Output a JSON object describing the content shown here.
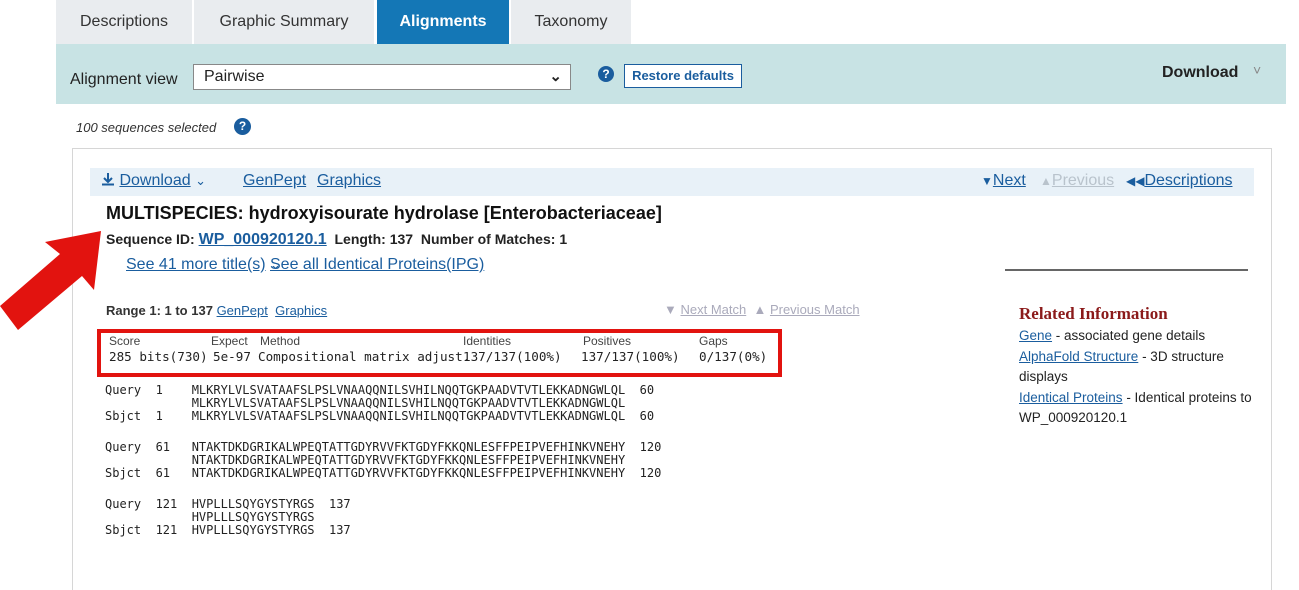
{
  "tabs": [
    {
      "label": "Descriptions"
    },
    {
      "label": "Graphic Summary"
    },
    {
      "label": "Alignments"
    },
    {
      "label": "Taxonomy"
    }
  ],
  "toolbar": {
    "alignment_view_label": "Alignment view",
    "alignment_view_value": "Pairwise",
    "help_glyph": "?",
    "restore_defaults": "Restore defaults",
    "download": "Download",
    "download_chevron": "˅"
  },
  "selection": {
    "text": "100 sequences selected",
    "help_glyph": "?"
  },
  "hit_bar": {
    "download": "Download",
    "genpept": "GenPept",
    "graphics": "Graphics",
    "next": "Next",
    "previous": "Previous",
    "descriptions": "Descriptions"
  },
  "hit": {
    "title": "MULTISPECIES: hydroxyisourate hydrolase [Enterobacteriaceae]",
    "seq_id_label": "Sequence ID:",
    "seq_id": "WP_000920120.1",
    "length_label": "Length:",
    "length": "137",
    "matches_label": "Number of Matches:",
    "matches": "1",
    "more_titles": "See 41 more title(s)",
    "ipg": "See all Identical Proteins(IPG)"
  },
  "range": {
    "label": "Range 1: 1 to 137",
    "genpept": "GenPept",
    "graphics": "Graphics",
    "next_match": "Next Match",
    "previous_match": "Previous Match"
  },
  "scores": {
    "headers": [
      "Score",
      "Expect",
      "Method",
      "Identities",
      "Positives",
      "Gaps"
    ],
    "values": [
      "285 bits(730)",
      "5e-97",
      "Compositional matrix adjust.",
      "137/137(100%)",
      "137/137(100%)",
      "0/137(0%)"
    ]
  },
  "alignment": [
    {
      "query": "Query  1    MLKRYLVLSVATAAFSLPSLVNAAQQNILSVHILNQQTGKPAADVTVTLEKKADNGWLQL  60",
      "middle": "            MLKRYLVLSVATAAFSLPSLVNAAQQNILSVHILNQQTGKPAADVTVTLEKKADNGWLQL",
      "sbjct": "Sbjct  1    MLKRYLVLSVATAAFSLPSLVNAAQQNILSVHILNQQTGKPAADVTVTLEKKADNGWLQL  60"
    },
    {
      "query": "Query  61   NTAKTDKDGRIKALWPEQTATTGDYRVVFKTGDYFKKQNLESFFPEIPVEFHINKVNEHY  120",
      "middle": "            NTAKTDKDGRIKALWPEQTATTGDYRVVFKTGDYFKKQNLESFFPEIPVEFHINKVNEHY",
      "sbjct": "Sbjct  61   NTAKTDKDGRIKALWPEQTATTGDYRVVFKTGDYFKKQNLESFFPEIPVEFHINKVNEHY  120"
    },
    {
      "query": "Query  121  HVPLLLSQYGYSTYRGS  137",
      "middle": "            HVPLLLSQYGYSTYRGS",
      "sbjct": "Sbjct  121  HVPLLLSQYGYSTYRGS  137"
    }
  ],
  "related": {
    "title": "Related Information",
    "items": [
      {
        "link": "Gene",
        "text": " - associated gene details"
      },
      {
        "link": "AlphaFold Structure",
        "text": " - 3D structure displays"
      },
      {
        "link": "Identical Proteins",
        "text": " - Identical proteins to WP_000920120.1"
      }
    ]
  },
  "colors": {
    "tab_active": "#1477b6",
    "toolbar_bg": "#c8e3e4",
    "highlight_box": "#e2130f",
    "annotation_arrow": "#e2130f",
    "link": "#1a5d9e"
  }
}
